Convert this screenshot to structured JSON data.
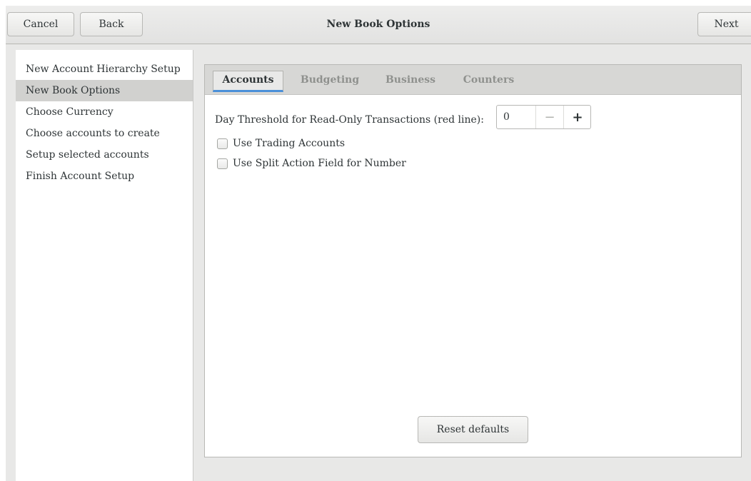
{
  "header": {
    "cancel_label": "Cancel",
    "back_label": "Back",
    "title": "New Book Options",
    "next_label": "Next"
  },
  "sidebar": {
    "items": [
      {
        "label": "New Account Hierarchy Setup",
        "selected": false
      },
      {
        "label": "New Book Options",
        "selected": true
      },
      {
        "label": "Choose Currency",
        "selected": false
      },
      {
        "label": "Choose accounts to create",
        "selected": false
      },
      {
        "label": "Setup selected accounts",
        "selected": false
      },
      {
        "label": "Finish Account Setup",
        "selected": false
      }
    ]
  },
  "tabs": [
    {
      "label": "Accounts",
      "active": true
    },
    {
      "label": "Budgeting",
      "active": false
    },
    {
      "label": "Business",
      "active": false
    },
    {
      "label": "Counters",
      "active": false
    }
  ],
  "accounts_tab": {
    "threshold_label": "Day Threshold for Read-Only Transactions (red line):",
    "threshold_value": "0",
    "minus_symbol": "−",
    "plus_symbol": "+",
    "options": [
      {
        "label": "Use Trading Accounts",
        "checked": false
      },
      {
        "label": "Use Split Action Field for Number",
        "checked": false
      }
    ]
  },
  "reset_label": "Reset defaults",
  "colors": {
    "tab_underline": "#4a90d9",
    "selected_row": "#d1d1cf",
    "window_bg": "#e8e8e7"
  }
}
